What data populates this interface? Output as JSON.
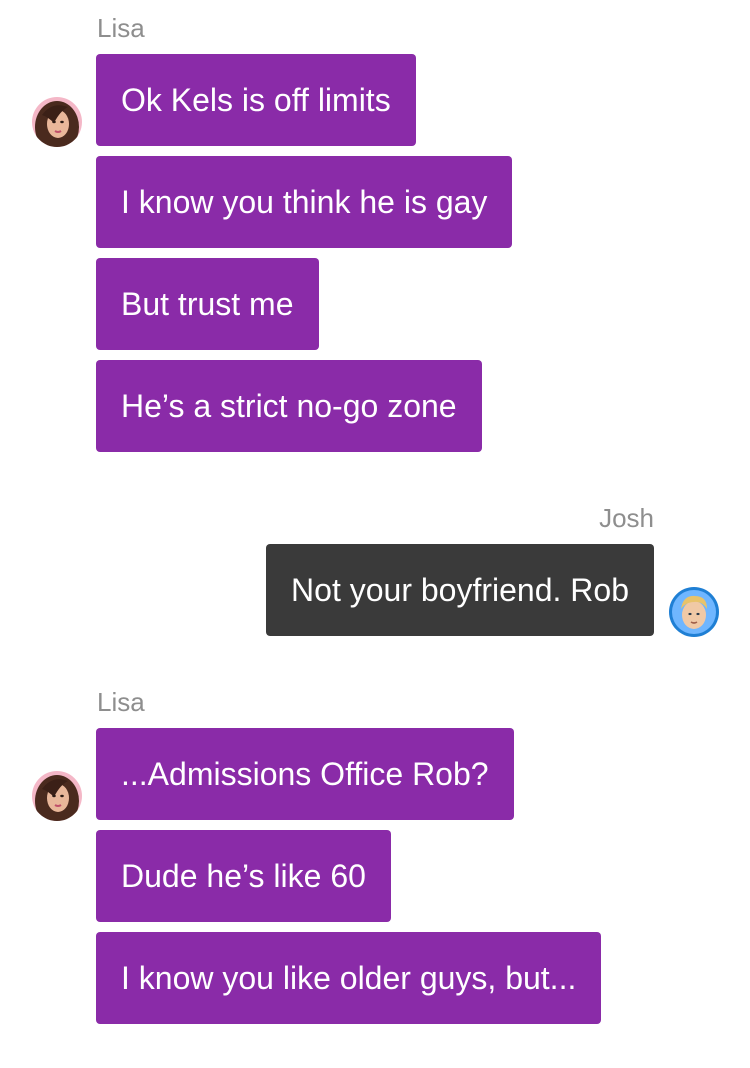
{
  "colors": {
    "lisa_bubble": "#8a2ba8",
    "josh_bubble": "#3a3a3a",
    "sender_name": "#8e8e8e",
    "bubble_text": "#ffffff"
  },
  "messages": [
    {
      "sender": "Lisa",
      "avatar_icon": "lisa-avatar-icon",
      "bubbles": [
        "Ok Kels is off limits",
        "I know you think he is gay",
        "But trust me",
        "He’s a strict no-go zone"
      ]
    },
    {
      "sender": "Josh",
      "avatar_icon": "josh-avatar-icon",
      "bubbles": [
        "Not your boyfriend. Rob"
      ]
    },
    {
      "sender": "Lisa",
      "avatar_icon": "lisa-avatar-icon",
      "bubbles": [
        "...Admissions Office Rob?",
        "Dude he’s like 60",
        "I know you like older guys, but..."
      ]
    }
  ]
}
